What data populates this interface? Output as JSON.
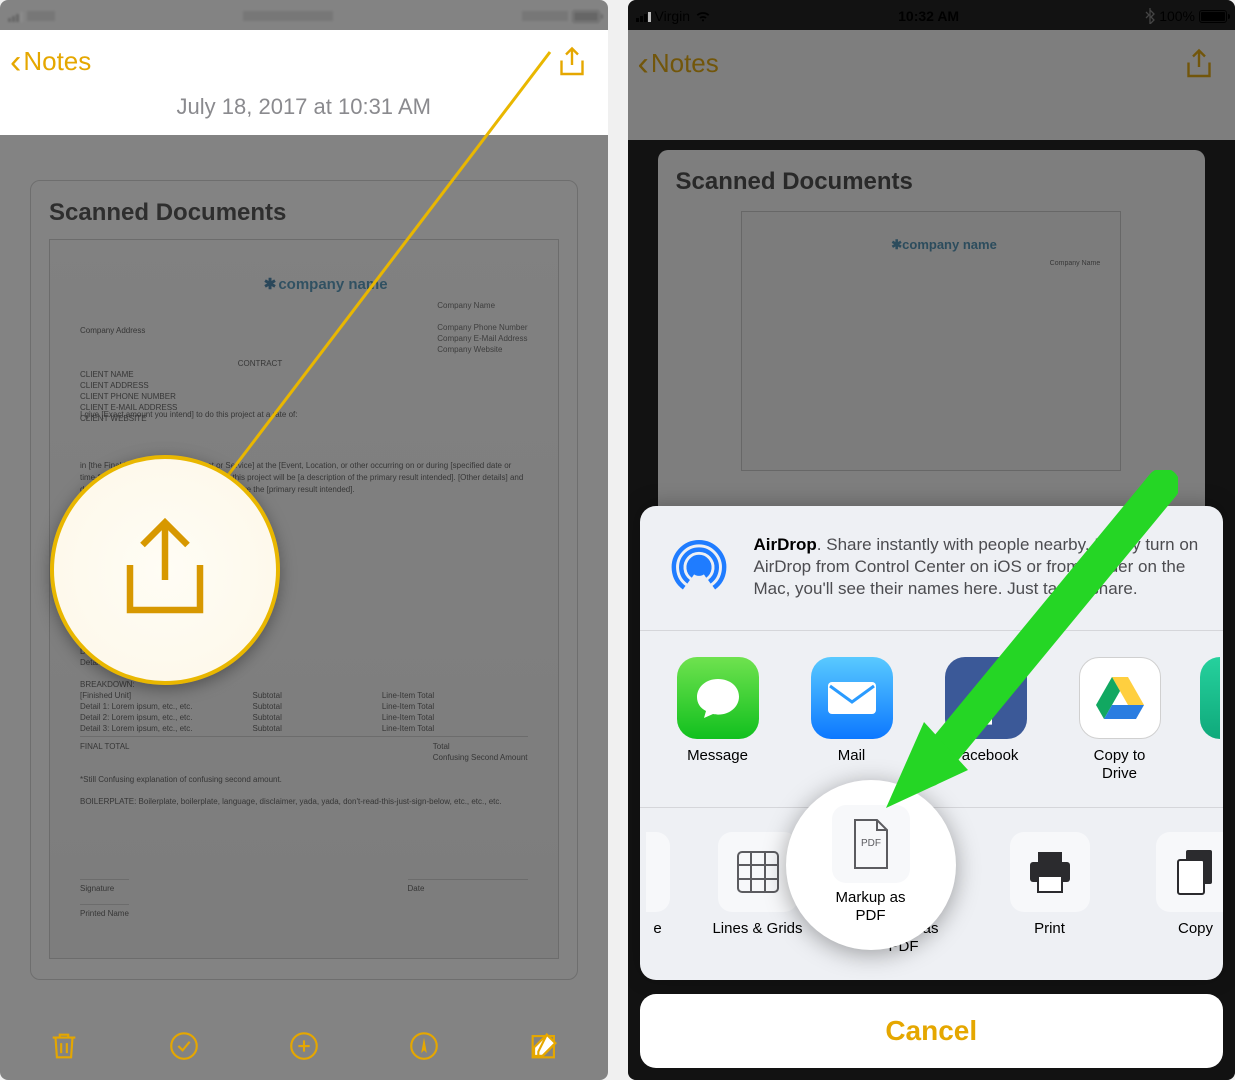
{
  "left": {
    "status": {
      "pixelated_center": "",
      "pixelated_right": ""
    },
    "back_label": "Notes",
    "note_date": "July 18, 2017 at 10:31 AM",
    "scanned_title": "Scanned Documents",
    "doc": {
      "logo": "company name",
      "company_address": "Company Address",
      "company_name": "Company Name",
      "phone": "Company Phone Number",
      "email": "Company E-Mail Address",
      "website": "Company Website",
      "contract": "CONTRACT",
      "client_name": "CLIENT NAME",
      "client_address": "CLIENT ADDRESS",
      "client_phone": "CLIENT PHONE NUMBER",
      "client_email": "CLIENT E-MAIL ADDRESS",
      "client_website": "CLIENT WEBSITE",
      "rate": "I give [Exact amount you intend] to do this project at a rate of:",
      "blurb": "in [the Final Product] [Type of Product or Service] at the [Event, Location, or other occurring on or during [specified date or time-frame]. [Units of goods or services] of this project will be [a description of the primary result intended]. [Other details] and details]. The purpose of this project is to achieve the [primary result intended].",
      "detail1": "Detail 1: Lorem ipsum, etc., etc.",
      "detail2": "Detail 2: Lorem ipsum, etc., etc.",
      "detail3": "Detail 3: Lorem ipsum, etc., etc.",
      "breakdown": "BREAKDOWN:",
      "finished": "[Finished Unit]",
      "subtotal": "Subtotal",
      "lineitem": "Line-Item Total",
      "total": "Total",
      "confusing": "Confusing Second Amount",
      "final_total": "FINAL TOTAL",
      "still": "*Still Confusing explanation of confusing second amount.",
      "boiler": "BOILERPLATE: Boilerplate, boilerplate, language, disclaimer, yada, yada, don't-read-this-just-sign-below, etc., etc., etc.",
      "signature": "Signature",
      "date": "Date",
      "printed": "Printed Name"
    },
    "zoom_target": "share-icon"
  },
  "right": {
    "status": {
      "carrier": "Virgin",
      "time": "10:32 AM",
      "battery_pct": "100%"
    },
    "back_label": "Notes",
    "scanned_title": "Scanned Documents",
    "doc_logo": "company name",
    "doc_company_name": "Company Name",
    "airdrop": {
      "title": "AirDrop",
      "body": ". Share instantly with people nearby. If they turn on AirDrop from Control Center on iOS or from Finder on the Mac, you'll see their names here. Just tap to share."
    },
    "apps": {
      "message": "Message",
      "mail": "Mail",
      "facebook": "Facebook",
      "drive_l1": "Copy to",
      "drive_l2": "Drive"
    },
    "actions": {
      "partial_left": "e",
      "lines": "Lines & Grids",
      "markup_l1": "Markup as",
      "markup_l2": "PDF",
      "pdf_badge": "PDF",
      "print": "Print",
      "copy": "Copy"
    },
    "cancel": "Cancel"
  }
}
